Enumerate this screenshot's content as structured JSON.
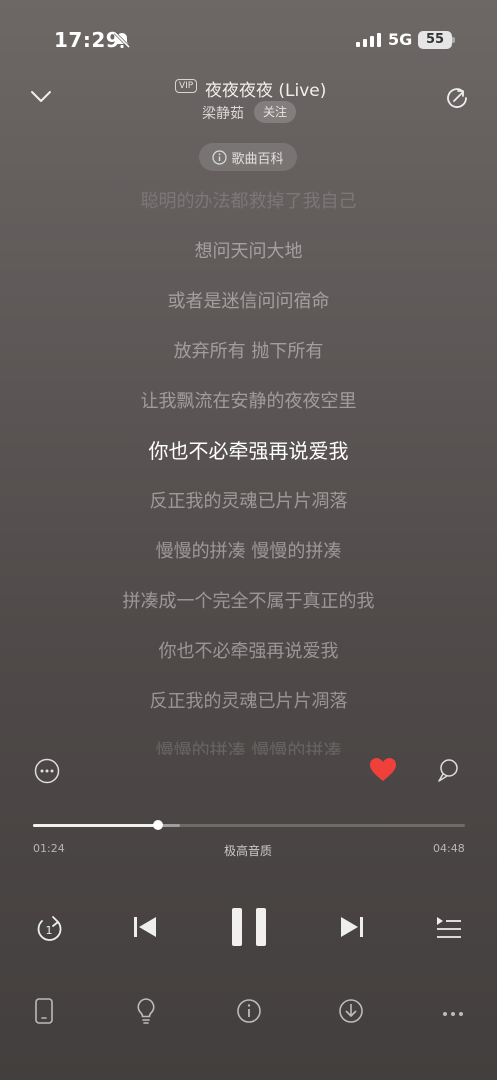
{
  "status_bar": {
    "time": "17:29",
    "network": "5G",
    "battery": "55"
  },
  "header": {
    "vip_badge": "VIP",
    "title": "夜夜夜夜 (Live)",
    "artist": "梁静茹",
    "follow_label": "关注",
    "wiki_label": "歌曲百科"
  },
  "lyrics": [
    "聪明的办法都救掉了我自己",
    "想问天问大地",
    "或者是迷信问问宿命",
    "放弃所有 抛下所有",
    "让我飘流在安静的夜夜空里",
    "你也不必牵强再说爱我",
    "反正我的灵魂已片片凋落",
    "慢慢的拼凑 慢慢的拼凑",
    "拼凑成一个完全不属于真正的我",
    "你也不必牵强再说爱我",
    "反正我的灵魂已片片凋落",
    "慢慢的拼凑 慢慢的拼凑"
  ],
  "active_lyric_index": 5,
  "player": {
    "current_time": "01:24",
    "duration": "04:48",
    "quality": "极高音质",
    "progress": 0.29,
    "buffered": 0.34,
    "liked": true
  },
  "colors": {
    "accent_heart": "#f0403c"
  }
}
